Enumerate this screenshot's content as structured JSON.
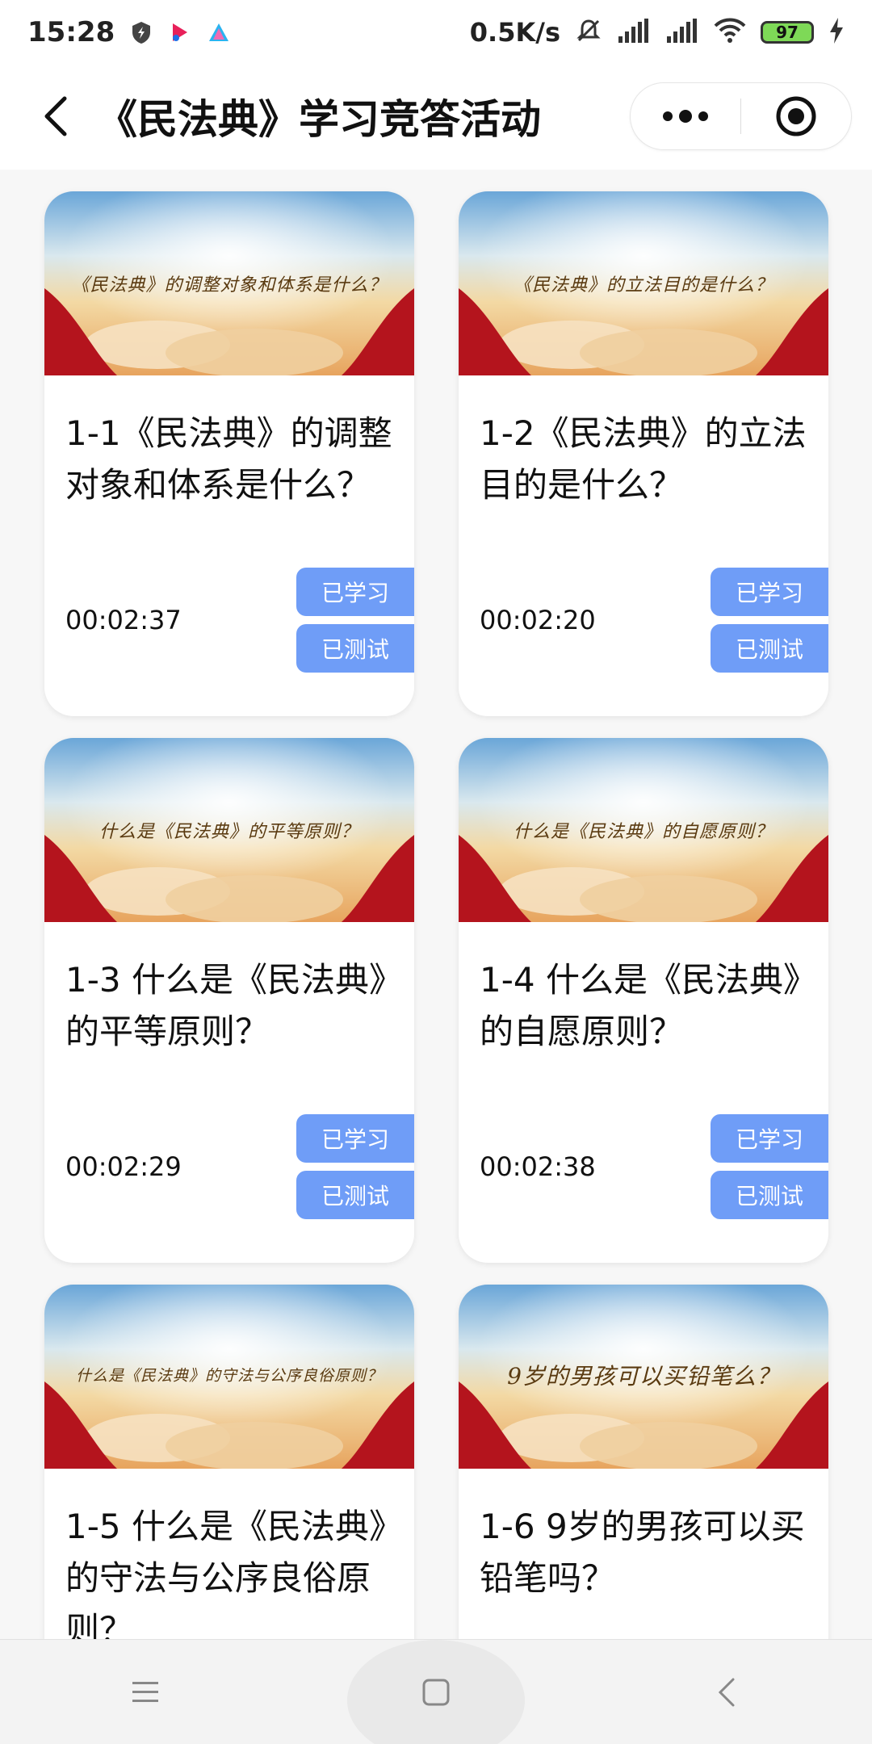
{
  "status_bar": {
    "time": "15:28",
    "network_speed": "0.5K/s",
    "battery_level": "97",
    "icons": [
      "shield-icon",
      "app-a-icon",
      "app-b-icon",
      "mute-icon",
      "signal-icon",
      "signal-icon",
      "wifi-icon",
      "charging-icon"
    ]
  },
  "header": {
    "title": "《民法典》学习竞答活动",
    "icons": [
      "back-arrow-icon",
      "more-dots-icon",
      "close-target-icon"
    ]
  },
  "colors": {
    "accent": "#6f9df7",
    "card_bg": "#ffffff",
    "page_bg": "#f7f7f7"
  },
  "cards": [
    {
      "thumb_text": "《民法典》的调整对象和体系是什么？",
      "title": "1-1《民法典》的调整对象和体系是什么？",
      "duration": "00:02:37",
      "learn_label": "已学习",
      "test_label": "已测试"
    },
    {
      "thumb_text": "《民法典》的立法目的是什么？",
      "title": "1-2《民法典》的立法目的是什么？",
      "duration": "00:02:20",
      "learn_label": "已学习",
      "test_label": "已测试"
    },
    {
      "thumb_text": "什么是《民法典》的平等原则？",
      "title": "1-3 什么是《民法典》的平等原则？",
      "duration": "00:02:29",
      "learn_label": "已学习",
      "test_label": "已测试"
    },
    {
      "thumb_text": "什么是《民法典》的自愿原则？",
      "title": "1-4 什么是《民法典》的自愿原则？",
      "duration": "00:02:38",
      "learn_label": "已学习",
      "test_label": "已测试"
    },
    {
      "thumb_text": "什么是《民法典》的守法与公序良俗原则？",
      "title": "1-5 什么是《民法典》的守法与公序良俗原则？",
      "duration": "",
      "learn_label": "",
      "test_label": ""
    },
    {
      "thumb_text": "9岁的男孩可以买铅笔么？",
      "title": "1-6 9岁的男孩可以买铅笔吗？",
      "duration": "",
      "learn_label": "",
      "test_label": ""
    }
  ],
  "nav": {
    "icons": [
      "menu-icon",
      "home-square-icon",
      "back-chevron-icon"
    ]
  }
}
